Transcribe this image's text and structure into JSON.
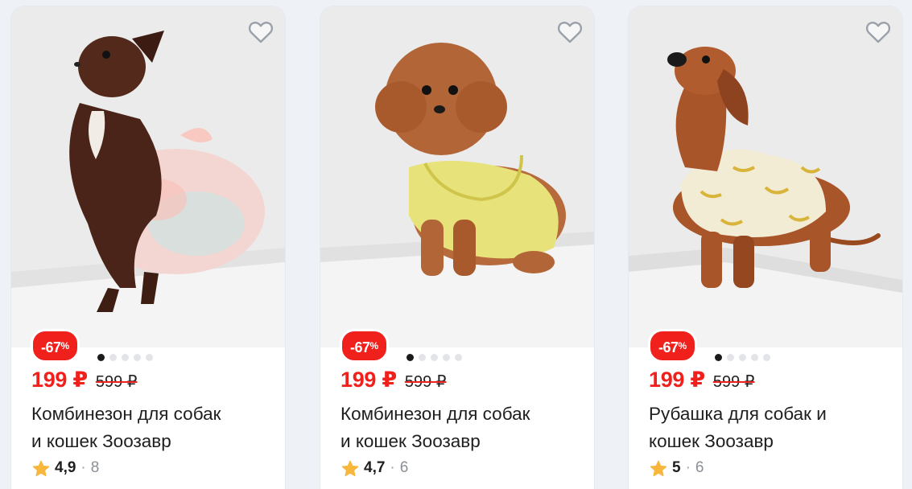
{
  "products": [
    {
      "discount": "-67",
      "discount_unit": "%",
      "price": "199 ₽",
      "old_price": "599 ₽",
      "title_line1": "Комбинезон для собак",
      "title_line2": "и кошек Зоозавр",
      "rating": "4,9",
      "separator": "·",
      "reviews": "8",
      "image": "chihuahua-in-pink-floral-dress",
      "photo_dots": 5,
      "active_dot": 0
    },
    {
      "discount": "-67",
      "discount_unit": "%",
      "price": "199 ₽",
      "old_price": "599 ₽",
      "title_line1": "Комбинезон для собак",
      "title_line2": "и кошек Зоозавр",
      "rating": "4,7",
      "separator": "·",
      "reviews": "6",
      "image": "poodle-in-yellow-jumpsuit",
      "photo_dots": 5,
      "active_dot": 0
    },
    {
      "discount": "-67",
      "discount_unit": "%",
      "price": "199 ₽",
      "old_price": "599 ₽",
      "title_line1": "Рубашка для собак и",
      "title_line2": "кошек Зоозавр",
      "rating": "5",
      "separator": "·",
      "reviews": "6",
      "image": "dachshund-in-banana-shirt",
      "photo_dots": 5,
      "active_dot": 0
    }
  ],
  "icons": {
    "favorite": "heart-outline-icon",
    "rating": "star-icon"
  },
  "colors": {
    "accent_red": "#f0201d",
    "star": "#f6b73c",
    "background": "#eef1f6"
  }
}
